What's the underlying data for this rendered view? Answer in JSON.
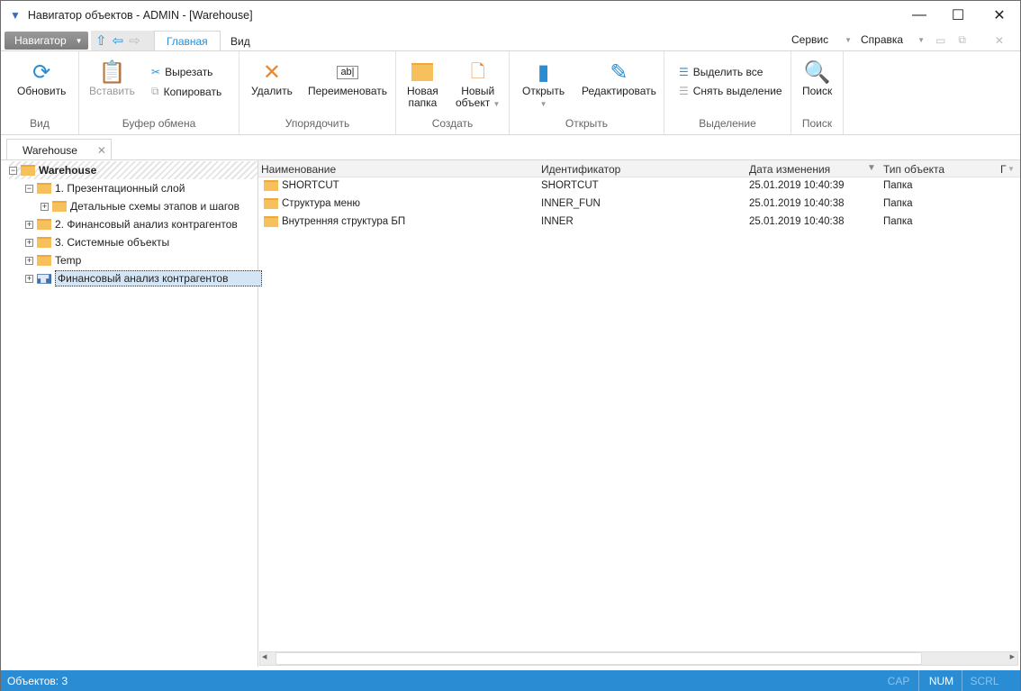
{
  "window": {
    "title": "Навигатор объектов - ADMIN - [Warehouse]"
  },
  "nav": {
    "navigator_label": "Навигатор",
    "tabs": [
      "Главная",
      "Вид"
    ],
    "right_menus": [
      "Сервис",
      "Справка"
    ]
  },
  "ribbon": {
    "refresh": "Обновить",
    "view_group": "Вид",
    "paste": "Вставить",
    "cut": "Вырезать",
    "copy": "Копировать",
    "clipboard_group": "Буфер обмена",
    "delete": "Удалить",
    "rename": "Переименовать",
    "rename_icon_text": "ab|",
    "organize_group": "Упорядочить",
    "new_folder": [
      "Новая",
      "папка"
    ],
    "new_object": [
      "Новый",
      "объект"
    ],
    "create_group": "Создать",
    "open": "Открыть",
    "edit": "Редактировать",
    "open_group": "Открыть",
    "select_all": "Выделить все",
    "deselect": "Снять выделение",
    "selection_group": "Выделение",
    "search": "Поиск",
    "search_group": "Поиск"
  },
  "doc_tab": "Warehouse",
  "tree": [
    {
      "label": "Warehouse",
      "level": 0,
      "expanded": true,
      "icon": "folder"
    },
    {
      "label": "1. Презентационный слой",
      "level": 1,
      "expanded": true,
      "icon": "folder"
    },
    {
      "label": "Детальные схемы этапов и шагов",
      "level": 2,
      "expanded": false,
      "icon": "folder"
    },
    {
      "label": "2. Финансовый анализ контрагентов",
      "level": 1,
      "expanded": false,
      "icon": "folder"
    },
    {
      "label": "3. Системные объекты",
      "level": 1,
      "expanded": false,
      "icon": "folder"
    },
    {
      "label": "Temp",
      "level": 1,
      "expanded": false,
      "icon": "folder"
    },
    {
      "label": "Финансовый анализ контрагентов",
      "level": 1,
      "expanded": false,
      "icon": "chart",
      "selected": true
    }
  ],
  "grid": {
    "columns": [
      "Наименование",
      "Идентификатор",
      "Дата изменения",
      "Тип объекта",
      "Г"
    ],
    "rows": [
      [
        "SHORTCUT",
        "SHORTCUT",
        "25.01.2019 10:40:39",
        "Папка"
      ],
      [
        "Структура меню",
        "INNER_FUN",
        "25.01.2019 10:40:38",
        "Папка"
      ],
      [
        "Внутренняя структура БП",
        "INNER",
        "25.01.2019 10:40:38",
        "Папка"
      ]
    ]
  },
  "status": {
    "objects": "Объектов: 3",
    "cap": "CAP",
    "num": "NUM",
    "scrl": "SCRL"
  },
  "colors": {
    "accent": "#2a8dd4",
    "folder": "#f6c15d"
  }
}
